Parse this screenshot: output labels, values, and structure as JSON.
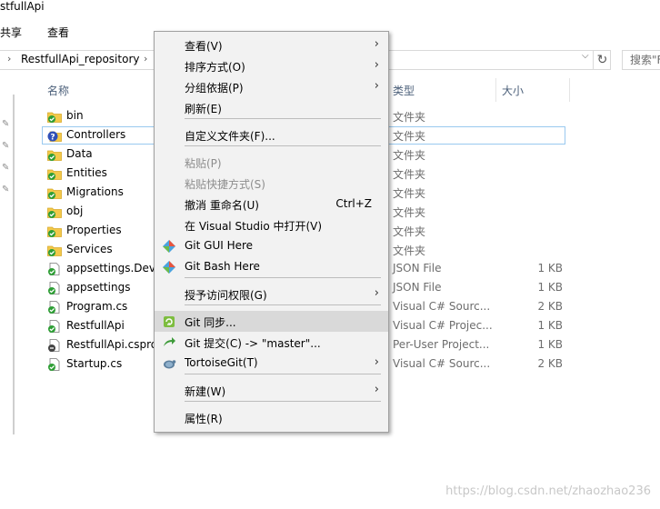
{
  "window": {
    "title": "stfullApi"
  },
  "ribbon": {
    "tabs": [
      "共享",
      "查看"
    ]
  },
  "address": {
    "path": "RestfullApi_repository",
    "search_placeholder": "搜索\"F"
  },
  "columns": {
    "name": "名称",
    "type": "类型",
    "size": "大小"
  },
  "files": [
    {
      "name": "bin",
      "type": "文件夹",
      "size": "",
      "icon": "folder-git-icon"
    },
    {
      "name": "Controllers",
      "type": "文件夹",
      "size": "",
      "icon": "folder-unversioned-icon"
    },
    {
      "name": "Data",
      "type": "文件夹",
      "size": "",
      "icon": "folder-git-icon"
    },
    {
      "name": "Entities",
      "type": "文件夹",
      "size": "",
      "icon": "folder-git-icon"
    },
    {
      "name": "Migrations",
      "type": "文件夹",
      "size": "",
      "icon": "folder-git-icon"
    },
    {
      "name": "obj",
      "type": "文件夹",
      "size": "",
      "icon": "folder-git-icon"
    },
    {
      "name": "Properties",
      "type": "文件夹",
      "size": "",
      "icon": "folder-git-icon"
    },
    {
      "name": "Services",
      "type": "文件夹",
      "size": "",
      "icon": "folder-git-icon"
    },
    {
      "name": "appsettings.Deve",
      "type": "JSON File",
      "size": "1 KB",
      "icon": "file-git-icon"
    },
    {
      "name": "appsettings",
      "type": "JSON File",
      "size": "1 KB",
      "icon": "file-git-icon"
    },
    {
      "name": "Program.cs",
      "type": "Visual C# Sourc...",
      "size": "2 KB",
      "icon": "file-git-icon"
    },
    {
      "name": "RestfullApi",
      "type": "Visual C# Projec...",
      "size": "1 KB",
      "icon": "file-git-icon"
    },
    {
      "name": "RestfullApi.csproj",
      "type": "Per-User Project...",
      "size": "1 KB",
      "icon": "file-modified-icon"
    },
    {
      "name": "Startup.cs",
      "type": "Visual C# Sourc...",
      "size": "2 KB",
      "icon": "file-git-icon"
    }
  ],
  "context_menu": {
    "items": [
      {
        "label": "查看(V)",
        "submenu": true
      },
      {
        "label": "排序方式(O)",
        "submenu": true
      },
      {
        "label": "分组依据(P)",
        "submenu": true
      },
      {
        "label": "刷新(E)"
      },
      {
        "label": "自定义文件夹(F)..."
      },
      {
        "label": "粘贴(P)",
        "disabled": true
      },
      {
        "label": "粘贴快捷方式(S)",
        "disabled": true
      },
      {
        "label": "撤消 重命名(U)",
        "shortcut": "Ctrl+Z"
      },
      {
        "label": "在 Visual Studio 中打开(V)"
      },
      {
        "label": "Git GUI Here",
        "icon": "git-diamond-icon"
      },
      {
        "label": "Git Bash Here",
        "icon": "git-diamond-icon"
      },
      {
        "label": "授予访问权限(G)",
        "submenu": true
      },
      {
        "label": "Git 同步...",
        "icon": "git-sync-icon",
        "highlighted": true
      },
      {
        "label": "Git 提交(C) -> \"master\"...",
        "icon": "git-commit-icon"
      },
      {
        "label": "TortoiseGit(T)",
        "icon": "tortoisegit-icon",
        "submenu": true
      },
      {
        "label": "新建(W)",
        "submenu": true
      },
      {
        "label": "属性(R)"
      }
    ]
  },
  "watermark": "https://blog.csdn.net/zhaozhao236",
  "colors": {
    "folder": "#f3c94a",
    "git_green": "#2e9e35",
    "git_question": "#2f50b8",
    "menu_bg": "#f2f2f2",
    "highlight": "#d9d9d9"
  }
}
